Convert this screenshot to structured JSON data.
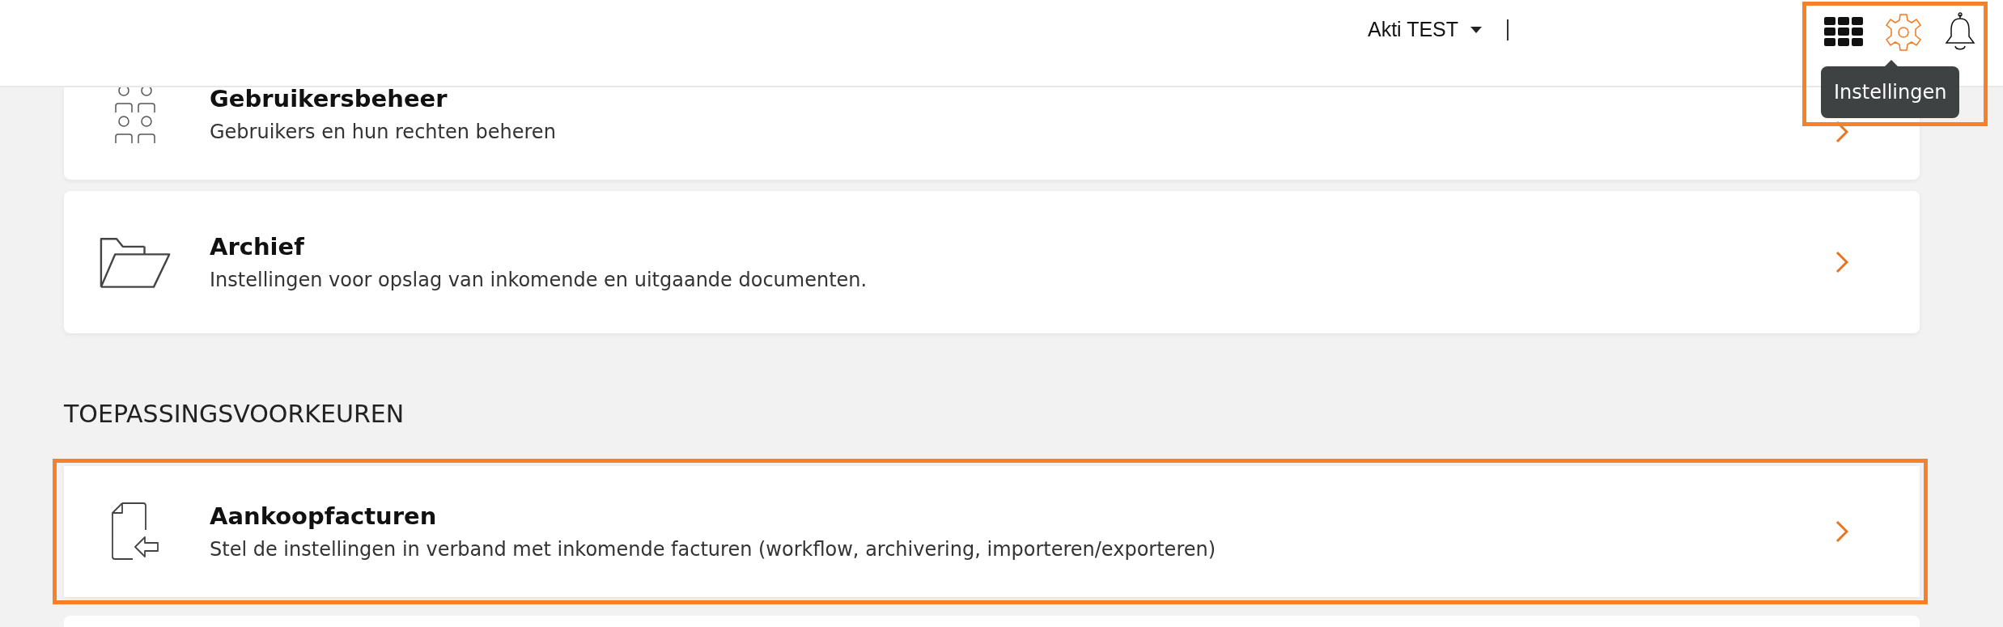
{
  "header": {
    "account": "Akti TEST",
    "toolbar": [
      {
        "kind": "apps",
        "active": false
      },
      {
        "kind": "settings",
        "active": true
      },
      {
        "kind": "bell",
        "active": false
      }
    ],
    "tooltip": "Instellingen",
    "highlighted": true
  },
  "sections": [
    {
      "cards": [
        {
          "kind": "card",
          "title": "Gebruikersbeheer",
          "description": "Gebruikers en hun rechten beheren",
          "highlighted": false
        },
        {
          "kind": "card",
          "title": "Archief",
          "description": "Instellingen voor opslag van inkomende en uitgaande documenten.",
          "highlighted": false
        }
      ]
    },
    {
      "heading": "TOEPASSINGSVOORKEUREN",
      "cards": [
        {
          "kind": "card",
          "title": "Aankoopfacturen",
          "description": "Stel de instellingen in verband met inkomende facturen (workflow, archivering, importeren/exporteren)",
          "highlighted": true
        },
        {
          "kind": "cut_off"
        }
      ]
    }
  ]
}
